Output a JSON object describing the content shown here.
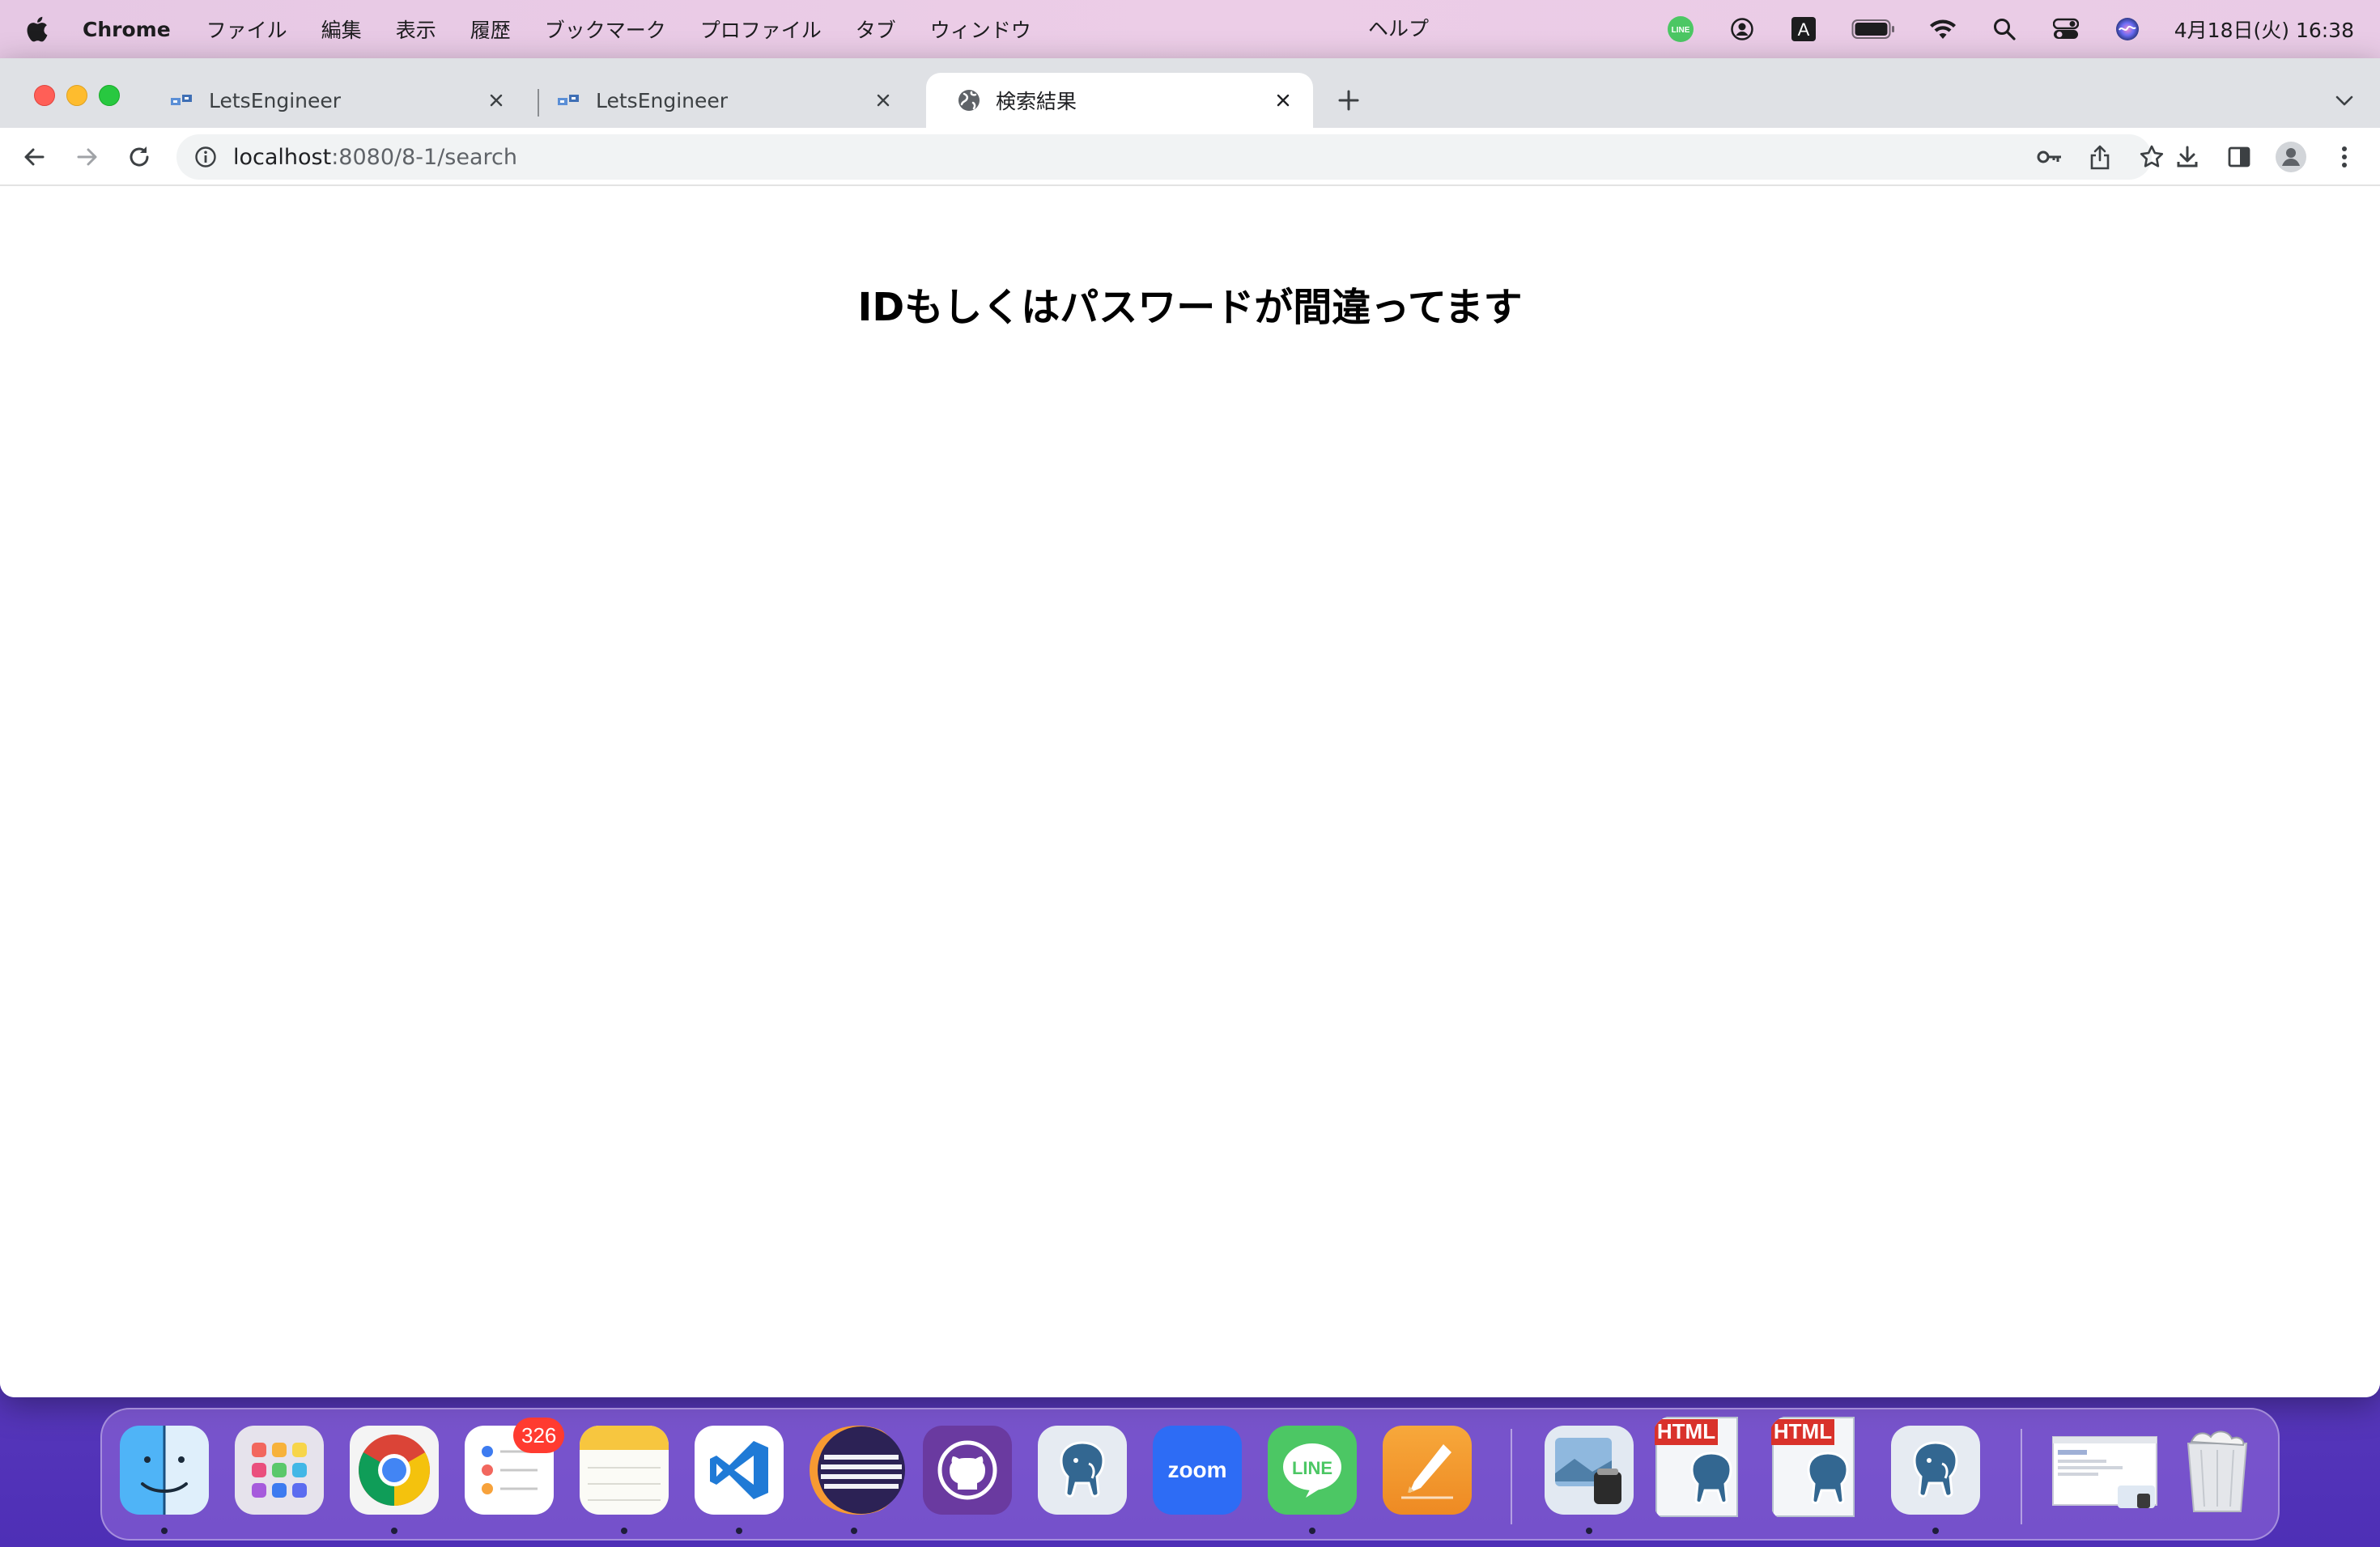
{
  "menubar": {
    "app_name": "Chrome",
    "menus": [
      "ファイル",
      "編集",
      "表示",
      "履歴",
      "ブックマーク",
      "プロファイル",
      "タブ",
      "ウィンドウ"
    ],
    "help": "ヘルプ",
    "clock": "4月18日(火)  16:38",
    "status_icons": [
      "line-icon",
      "user-circle-icon",
      "input-source-icon",
      "battery-icon",
      "wifi-icon",
      "spotlight-icon",
      "control-center-icon",
      "siri-icon"
    ],
    "input_source_label": "A",
    "line_label": "LINE"
  },
  "browser": {
    "tabs": [
      {
        "title": "LetsEngineer",
        "active": false
      },
      {
        "title": "LetsEngineer",
        "active": false
      },
      {
        "title": "検索結果",
        "active": true
      }
    ],
    "url_host": "localhost",
    "url_path": ":8080/8-1/search"
  },
  "page": {
    "heading": "IDもしくはパスワードが間違ってます"
  },
  "dock": {
    "apps": [
      "finder-icon",
      "launchpad-icon",
      "chrome-icon",
      "reminders-icon",
      "notes-icon",
      "vscode-icon",
      "eclipse-icon",
      "github-desktop-icon",
      "postgresql-icon",
      "zoom-icon",
      "line-icon",
      "pages-icon"
    ],
    "reminders_badge": "326",
    "zoom_label": "zoom",
    "line_label": "LINE",
    "html_label": "HTML",
    "recent": [
      "preview-icon",
      "html-pgadmin-icon",
      "html-pgadmin-icon",
      "postgresql-icon"
    ],
    "other": [
      "window-thumbnail",
      "trash-icon"
    ]
  },
  "colors": {
    "chrome_tabstrip": "#dfe1e5",
    "omnibox": "#f1f3f4",
    "menubar": "#eccde7"
  }
}
